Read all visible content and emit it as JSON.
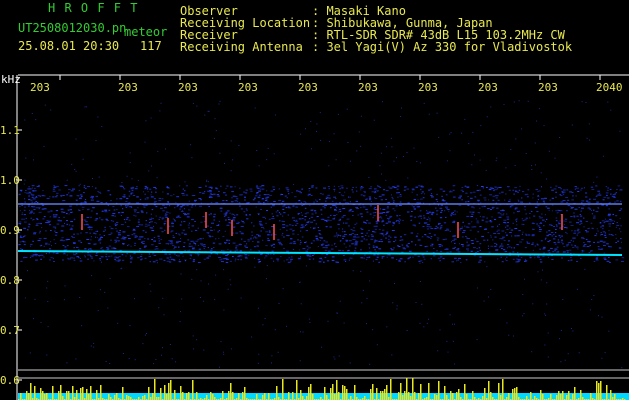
{
  "header": {
    "brand": "H R O F F T",
    "filename": "UT2508012030.pn",
    "mode": "meteor",
    "datetime": "25.08.01 20:30",
    "count": "117",
    "info_labels": [
      "Observer",
      "Receiving Location",
      "Receiver",
      "Receiving Antenna"
    ],
    "info_values": [
      ": Masaki Kano",
      ": Shibukawa, Gunma, Japan",
      ": RTL-SDR SDR# 43dB L15 103.2MHz CW",
      ": 3el Yagi(V) Az 330 for Vladivostok"
    ]
  },
  "axis": {
    "unit": "kHz",
    "y_ticks": [
      "1.1",
      "1.0",
      "0.9",
      "0.8",
      "0.7",
      "0.6"
    ],
    "x_ticks": [
      "203",
      "203",
      "203",
      "203",
      "203",
      "203",
      "203",
      "203",
      "203",
      "2040"
    ]
  },
  "colors": {
    "background": "#000000",
    "signal": "#00e5ff",
    "band": "#1a2bd4",
    "meteor": "#ff4040",
    "bars": "#e8e820"
  }
}
